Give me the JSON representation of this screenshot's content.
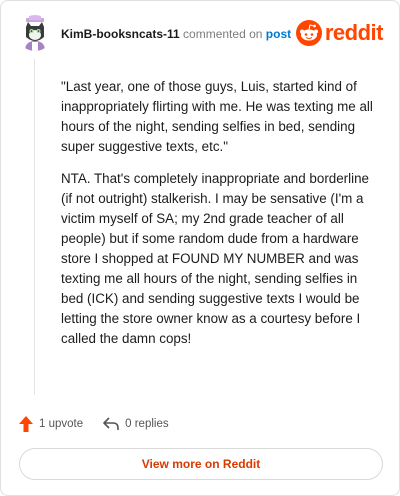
{
  "header": {
    "username": "KimB-booksncats-11",
    "action_text": "commented on",
    "post_link": "post",
    "brand": "reddit"
  },
  "comment": {
    "paragraphs": [
      "\"Last year, one of those guys, Luis, started kind of inappropriately flirting with me. He was texting me all hours of the night, sending selfies in bed, sending super suggestive texts, etc.\"",
      "NTA. That's completely inappropriate and borderline (if not outright) stalkerish. I may be sensative (I'm a victim myself of SA; my 2nd grade teacher of all people) but if some random dude from a hardware store I shopped at FOUND MY NUMBER and was texting me all hours of the night, sending selfies in bed (ICK) and sending suggestive texts I would be letting the store owner know as a courtesy before I called the damn cops!"
    ]
  },
  "actions": {
    "upvotes": "1 upvote",
    "replies": "0 replies"
  },
  "footer": {
    "view_more": "View more on Reddit"
  },
  "colors": {
    "brand_orange": "#ff4500",
    "link_blue": "#0079d3",
    "button_text": "#d93a00"
  },
  "icons": {
    "avatar": "cat-avatar-icon",
    "logo": "reddit-logo-icon",
    "upvote": "upvote-arrow-icon",
    "reply": "reply-arrow-icon"
  }
}
